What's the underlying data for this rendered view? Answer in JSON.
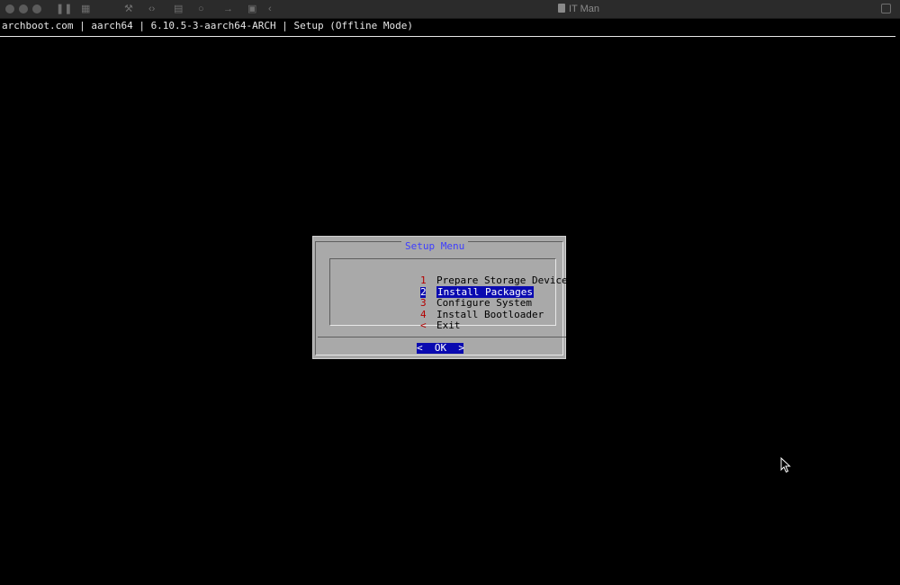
{
  "window": {
    "title": "IT Man"
  },
  "terminal": {
    "header": "archboot.com | aarch64 | 6.10.5-3-aarch64-ARCH | Setup (Offline Mode)"
  },
  "dialog": {
    "title": "Setup Menu",
    "items": [
      {
        "tag": "1",
        "label": "Prepare Storage Device"
      },
      {
        "tag": "2",
        "label": "Install Packages"
      },
      {
        "tag": "3",
        "label": "Configure System"
      },
      {
        "tag": "4",
        "label": "Install Bootloader"
      },
      {
        "tag": "<",
        "label": "Exit"
      }
    ],
    "selected_index": 1,
    "ok_label": "<  OK  >"
  },
  "colors": {
    "terminal_bg": "#000000",
    "dialog_bg": "#a9a9a9",
    "selection": "#0a0ab0",
    "tag": "#b40000",
    "title": "#3d3dff"
  },
  "icons": {
    "close": "traffic-light-close-icon",
    "minimize": "traffic-light-minimize-icon",
    "zoom": "traffic-light-zoom-icon",
    "document": "document-icon",
    "cursor": "mouse-pointer-icon"
  }
}
